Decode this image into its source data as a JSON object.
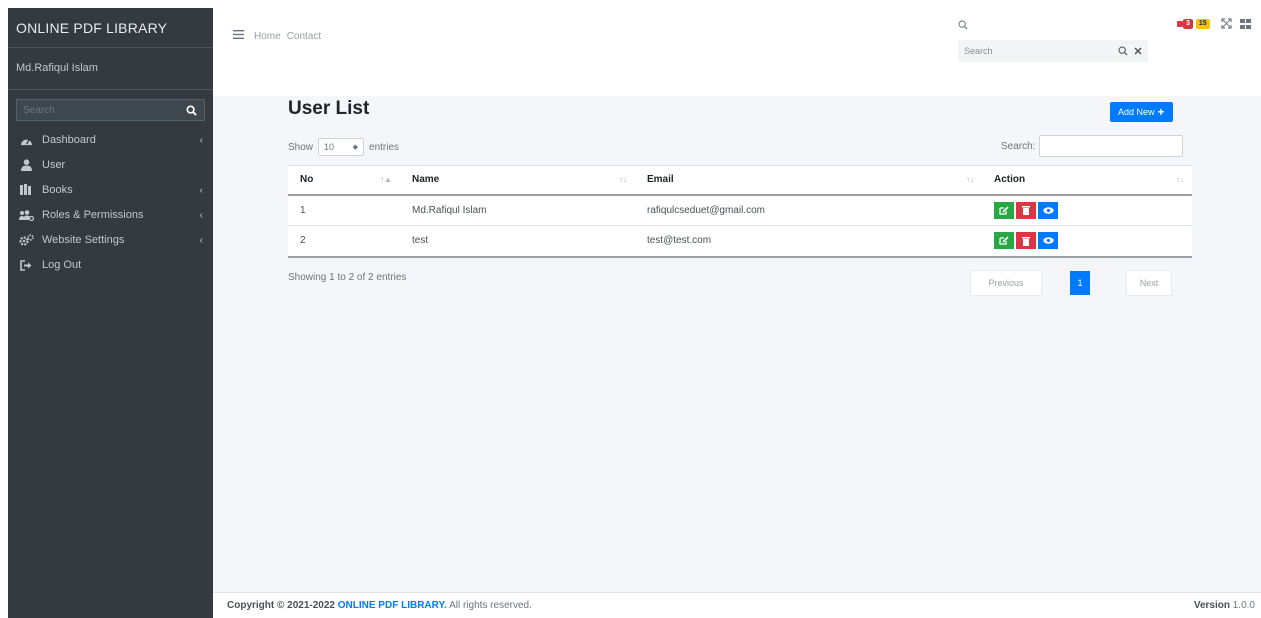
{
  "sidebar": {
    "brand": "ONLINE PDF LIBRARY",
    "user_name": "Md.Rafiqul Islam",
    "search_placeholder": "Search",
    "items": [
      {
        "label": "Dashboard",
        "icon": "dashboard-icon",
        "has_chevron": true
      },
      {
        "label": "User",
        "icon": "user-icon",
        "has_chevron": false
      },
      {
        "label": "Books",
        "icon": "book-icon",
        "has_chevron": true
      },
      {
        "label": "Roles & Permissions",
        "icon": "users-cog-icon",
        "has_chevron": true
      },
      {
        "label": "Website Settings",
        "icon": "cogs-icon",
        "has_chevron": true
      },
      {
        "label": "Log Out",
        "icon": "sign-out-icon",
        "has_chevron": false
      }
    ],
    "chevron": "‹"
  },
  "topbar": {
    "links": [
      "Home",
      "Contact"
    ],
    "search_placeholder": "Search",
    "badge_messages": "3",
    "badge_notifications": "15"
  },
  "main": {
    "title": "User List",
    "add_new_label": "Add New",
    "show_label": "Show",
    "entries_value": "10",
    "entries_label": "entries",
    "search_label": "Search:",
    "columns": [
      "No",
      "Name",
      "Email",
      "Action"
    ],
    "rows": [
      {
        "no": "1",
        "name": "Md.Rafiqul Islam",
        "email": "rafiqulcseduet@gmail.com"
      },
      {
        "no": "2",
        "name": "test",
        "email": "test@test.com"
      }
    ],
    "info": "Showing 1 to 2 of 2 entries",
    "pagination": {
      "previous": "Previous",
      "current": "1",
      "next": "Next"
    }
  },
  "footer": {
    "copyright_prefix": "Copyright © 2021-2022",
    "brand": "ONLINE PDF LIBRARY.",
    "rights": "All rights reserved.",
    "version_label": "Version",
    "version_value": "1.0.0"
  },
  "colors": {
    "sidebar_bg": "#343a40",
    "primary": "#007bff",
    "success": "#28a745",
    "danger": "#dc3545",
    "warning": "#ffc107",
    "content_bg": "#f4f6f9"
  }
}
